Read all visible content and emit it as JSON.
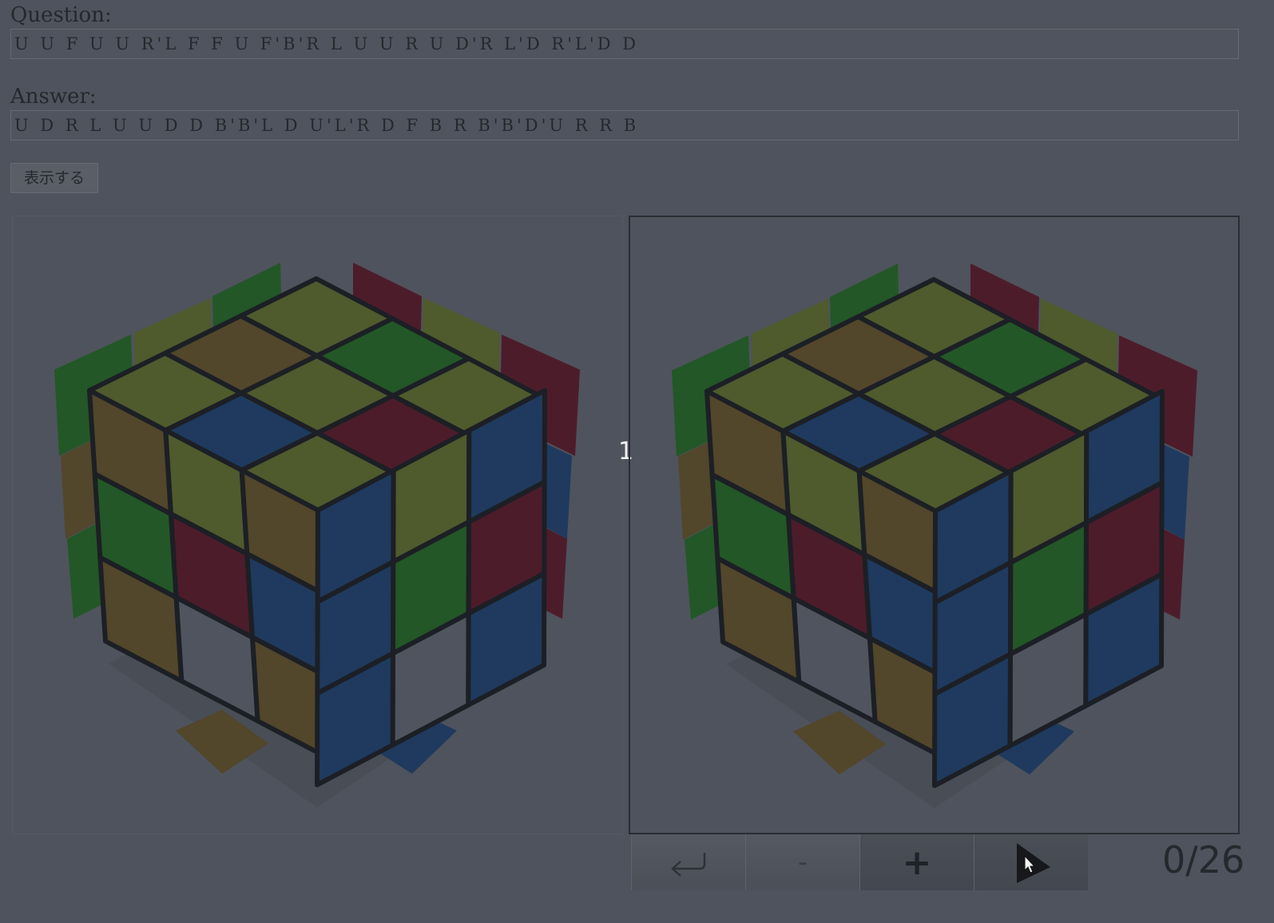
{
  "question": {
    "label": "Question:",
    "value": "U U F U U R'L F F U F'B'R L U U R U D'R L'D R'L'D D"
  },
  "answer": {
    "label": "Answer:",
    "value": "U D R L U U D D B'B'L D U'L'R D F B R B'B'D'U R R B"
  },
  "show_button": {
    "label": "表示する"
  },
  "step_marker": "1",
  "controls": {
    "back_icon": "return-arrow-icon",
    "minus_label": "-",
    "plus_label": "+",
    "play_icon": "play-icon"
  },
  "counter": {
    "current": "0",
    "separator": "/",
    "total": "26"
  },
  "cube_colors": {
    "Y": "#4f5a2d",
    "G": "#235727",
    "R": "#4d1c2a",
    "O": "#52462b",
    "B": "#1f3a5e",
    "W": "#50545e",
    "edge": "#1c1f25"
  },
  "cube_left": {
    "top": [
      [
        "Y",
        "G",
        "Y"
      ],
      [
        "O",
        "Y",
        "R"
      ],
      [
        "Y",
        "B",
        "Y"
      ]
    ],
    "left": [
      [
        "O",
        "Y",
        "O"
      ],
      [
        "G",
        "R",
        "B"
      ],
      [
        "O",
        "W",
        "O"
      ]
    ],
    "right": [
      [
        "B",
        "Y",
        "B"
      ],
      [
        "B",
        "G",
        "R"
      ],
      [
        "B",
        "W",
        "B"
      ]
    ],
    "ghost_left": [
      "G",
      "Y",
      "G",
      "O",
      "G"
    ],
    "ghost_right": [
      "R",
      "Y",
      "R",
      "B",
      "R"
    ],
    "ghost_bottom": [
      "O",
      "B"
    ]
  },
  "cube_right": {
    "top": [
      [
        "Y",
        "G",
        "Y"
      ],
      [
        "O",
        "Y",
        "R"
      ],
      [
        "Y",
        "B",
        "Y"
      ]
    ],
    "left": [
      [
        "O",
        "Y",
        "O"
      ],
      [
        "G",
        "R",
        "B"
      ],
      [
        "O",
        "W",
        "O"
      ]
    ],
    "right": [
      [
        "B",
        "Y",
        "B"
      ],
      [
        "B",
        "G",
        "R"
      ],
      [
        "B",
        "W",
        "B"
      ]
    ],
    "ghost_left": [
      "G",
      "Y",
      "G",
      "O",
      "G"
    ],
    "ghost_right": [
      "R",
      "Y",
      "R",
      "B",
      "R"
    ],
    "ghost_bottom": [
      "O",
      "B"
    ]
  }
}
